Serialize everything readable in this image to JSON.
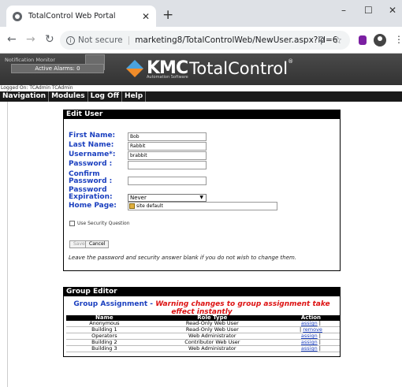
{
  "browser": {
    "tab_title": "TotalControl Web Portal",
    "new_tab": "+",
    "not_secure": "Not secure",
    "url": "marketing8/TotalControlWeb/NewUser.aspx?id=6",
    "window_controls": [
      "–",
      "☐",
      "✕"
    ]
  },
  "header": {
    "notification_title": "Notification Monitor",
    "active_alarms": "Active Alarms: 0",
    "logo_kmc": "KMC",
    "logo_total": "TotalControl",
    "logo_tm": "®",
    "logo_sub": "Automation Software",
    "logged_on": "Logged On: TCAdmin TCAdmin"
  },
  "menu": [
    "Navigation",
    "Modules",
    "Log Off",
    "Help"
  ],
  "edit_user": {
    "title": "Edit User",
    "first_name_label": "First Name:",
    "first_name_value": "Bob",
    "last_name_label": "Last Name:",
    "last_name_value": "Rabbit",
    "username_label": "Username*:",
    "username_value": "brabbit",
    "password_label": "Password :",
    "confirm_label_1": "Confirm",
    "confirm_label_2": "Password :",
    "expiration_label_1": "Password",
    "expiration_label_2": "Expiration:",
    "expiration_value": "Never",
    "home_page_label": "Home Page:",
    "home_page_value": "site default",
    "security_question_label": "Use Security Question",
    "save_label": "Save",
    "cancel_label": "Cancel",
    "note": "Leave the password and security answer blank if you do not wish to change them."
  },
  "group_editor": {
    "title": "Group Editor",
    "assignment_title": "Group Assignment",
    "dash": " - ",
    "warning": "Warning changes to group assignment take effect instantly",
    "columns": [
      "Name",
      "Role Type",
      "Action"
    ],
    "rows": [
      {
        "name": "Anonymous",
        "role": "Read-Only Web User",
        "action": "assign",
        "pre": "",
        "post": " |"
      },
      {
        "name": "Building 1",
        "role": "Read-Only Web User",
        "action": "remove",
        "pre": "| ",
        "post": ""
      },
      {
        "name": "Operators",
        "role": "Web Administrator",
        "action": "assign",
        "pre": "",
        "post": " |"
      },
      {
        "name": "Building 2",
        "role": "Contributor Web User",
        "action": "assign",
        "pre": "",
        "post": " |"
      },
      {
        "name": "Building 3",
        "role": "Web Administrator",
        "action": "assign",
        "pre": "",
        "post": " |"
      }
    ]
  }
}
